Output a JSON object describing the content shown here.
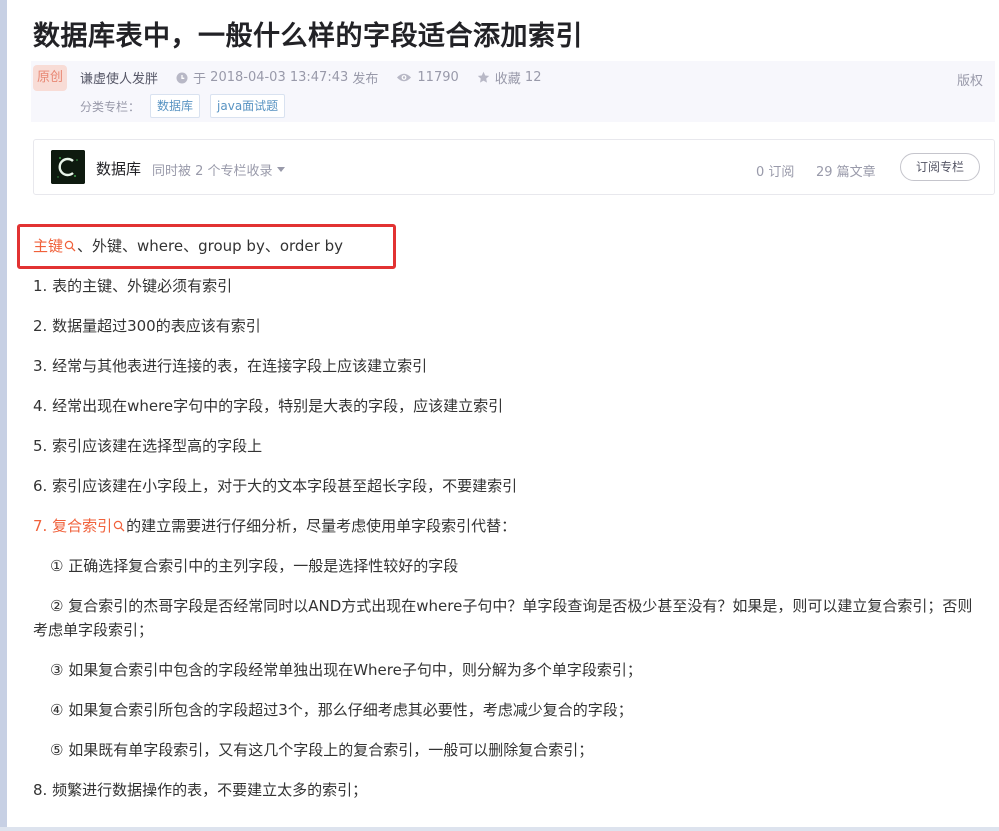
{
  "article": {
    "title": "数据库表中，一般什么样的字段适合添加索引"
  },
  "meta": {
    "original_label": "原创",
    "author": "谦虚使人发胖",
    "publish_prefix": "于",
    "publish_time": "2018-04-03 13:47:43",
    "publish_suffix": "发布",
    "views": "11790",
    "favorite_label": "收藏",
    "favorite_count": "12",
    "copyright_label": "版权",
    "category_label": "分类专栏：",
    "categories": [
      "数据库",
      "java面试题"
    ]
  },
  "column": {
    "name": "数据库",
    "collected_text": "同时被 2 个专栏收录",
    "subscribers": "0 订阅",
    "articles": "29 篇文章",
    "subscribe_button": "订阅专栏"
  },
  "content": {
    "intro_keyword": "主键",
    "intro_rest": "、外键、where、group by、order by",
    "items": [
      "1. 表的主键、外键必须有索引",
      "2. 数据量超过300的表应该有索引",
      "3. 经常与其他表进行连接的表，在连接字段上应该建立索引",
      "4. 经常出现在where字句中的字段，特别是大表的字段，应该建立索引",
      "5. 索引应该建在选择型高的字段上",
      "6. 索引应该建在小字段上，对于大的文本字段甚至超长字段，不要建索引"
    ],
    "item7_prefix": "7.",
    "item7_keyword": "复合索引",
    "item7_rest": "的建立需要进行仔细分析，尽量考虑使用单字段索引代替：",
    "sub1": "① 正确选择复合索引中的主列字段，一般是选择性较好的字段",
    "sub2": "② 复合索引的杰哥字段是否经常同时以AND方式出现在where子句中？单字段查询是否极少甚至没有？如果是，则可以建立复合索引；否则考虑单字段索引；",
    "sub3": "③ 如果复合索引中包含的字段经常单独出现在Where子句中，则分解为多个单字段索引；",
    "sub4": "④ 如果复合索引所包含的字段超过3个，那么仔细考虑其必要性，考虑减少复合的字段；",
    "sub5": "⑤ 如果既有单字段索引，又有这几个字段上的复合索引，一般可以删除复合索引；",
    "item8": "8. 频繁进行数据操作的表，不要建立太多的索引；"
  }
}
